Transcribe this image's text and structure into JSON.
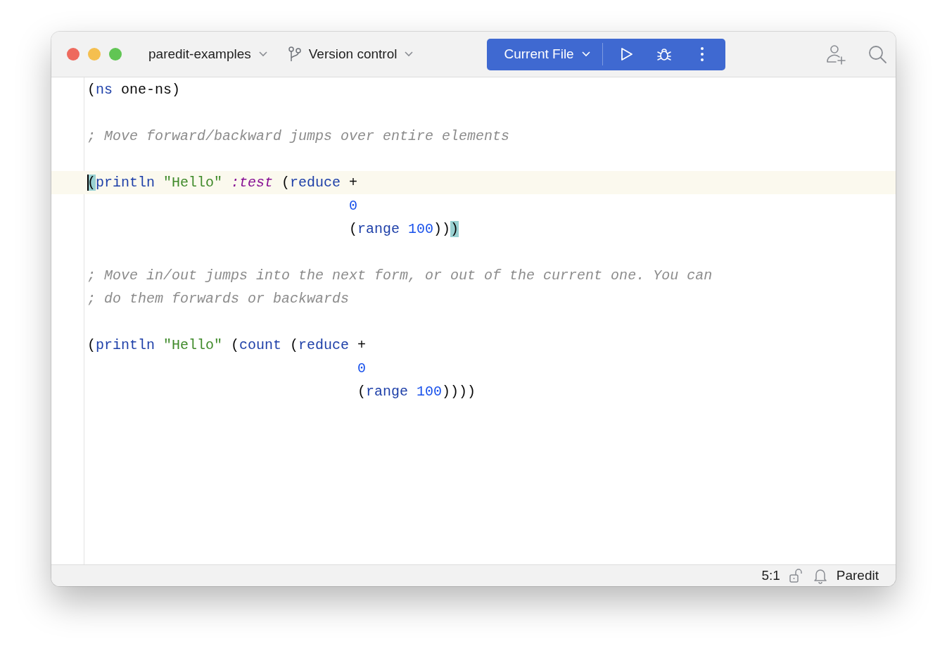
{
  "toolbar": {
    "project": "paredit-examples",
    "vcs": "Version control",
    "run_config": "Current File"
  },
  "editor": {
    "lines": [
      {
        "current": false,
        "tokens": [
          {
            "kind": "plain",
            "text": "("
          },
          {
            "kind": "keyword",
            "text": "ns"
          },
          {
            "kind": "plain",
            "text": " one-ns)"
          }
        ]
      },
      {
        "current": false
      },
      {
        "current": false,
        "tokens": [
          {
            "kind": "comment",
            "text": "; Move forward/backward jumps over entire elements"
          }
        ]
      },
      {
        "current": false
      },
      {
        "current": true,
        "tokens": [
          {
            "kind": "match",
            "text": "("
          },
          {
            "kind": "keyword",
            "text": "println"
          },
          {
            "kind": "string",
            "text": " \"Hello\""
          },
          {
            "kind": "symbol",
            "text": " :test"
          },
          {
            "kind": "plain",
            "text": " ("
          },
          {
            "kind": "keyword",
            "text": "reduce"
          },
          {
            "kind": "plain",
            "text": " +"
          }
        ]
      },
      {
        "current": false,
        "tokens": [
          {
            "kind": "number",
            "text": "                               0"
          }
        ]
      },
      {
        "current": false,
        "tokens": [
          {
            "kind": "plain",
            "text": "                               ("
          },
          {
            "kind": "keyword",
            "text": "range"
          },
          {
            "kind": "number",
            "text": " 100"
          },
          {
            "kind": "plain",
            "text": "))"
          },
          {
            "kind": "match",
            "text": ")"
          }
        ]
      },
      {
        "current": false
      },
      {
        "current": false,
        "tokens": [
          {
            "kind": "comment",
            "text": "; Move in/out jumps into the next form, or out of the current one. You can"
          }
        ]
      },
      {
        "current": false,
        "tokens": [
          {
            "kind": "comment",
            "text": "; do them forwards or backwards"
          }
        ]
      },
      {
        "current": false
      },
      {
        "current": false,
        "tokens": [
          {
            "kind": "plain",
            "text": "("
          },
          {
            "kind": "keyword",
            "text": "println"
          },
          {
            "kind": "string",
            "text": " \"Hello\""
          },
          {
            "kind": "plain",
            "text": " ("
          },
          {
            "kind": "keyword",
            "text": "count"
          },
          {
            "kind": "plain",
            "text": " ("
          },
          {
            "kind": "keyword",
            "text": "reduce"
          },
          {
            "kind": "plain",
            "text": " +"
          }
        ]
      },
      {
        "current": false,
        "tokens": [
          {
            "kind": "number",
            "text": "                                0"
          }
        ]
      },
      {
        "current": false,
        "tokens": [
          {
            "kind": "plain",
            "text": "                                ("
          },
          {
            "kind": "keyword",
            "text": "range"
          },
          {
            "kind": "number",
            "text": " 100"
          },
          {
            "kind": "plain",
            "text": "))))"
          }
        ]
      }
    ]
  },
  "status_bar": {
    "position": "5:1",
    "mode": "Paredit"
  }
}
